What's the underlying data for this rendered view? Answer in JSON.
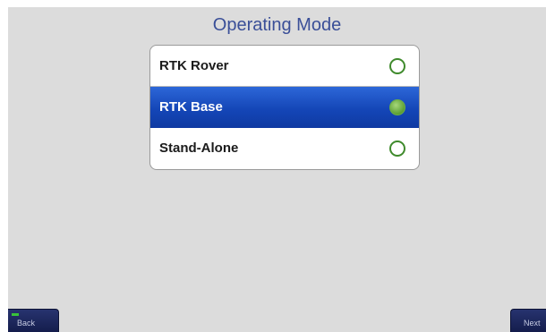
{
  "screen": {
    "title": "Operating Mode"
  },
  "modes": [
    {
      "label": "RTK Rover",
      "selected": false
    },
    {
      "label": "RTK Base",
      "selected": true
    },
    {
      "label": "Stand-Alone",
      "selected": false
    }
  ],
  "nav": {
    "back_label": "Back",
    "next_label": "Next"
  },
  "colors": {
    "background": "#dcdcdc",
    "title": "#3a4f98",
    "selected_row": "#1446b7",
    "radio_green": "#5c9f34",
    "nav_button": "#1f2a60"
  },
  "icons": {
    "radio_unselected": "radio-empty-icon",
    "radio_selected": "radio-filled-icon",
    "back_indicator": "status-led-icon"
  }
}
